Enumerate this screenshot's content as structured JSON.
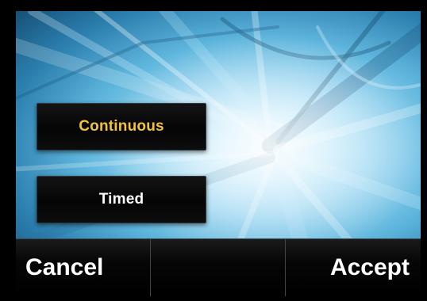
{
  "options": {
    "continuous_label": "Continuous",
    "timed_label": "Timed"
  },
  "softkeys": {
    "left_label": "Cancel",
    "middle_label": "",
    "right_label": "Accept"
  },
  "colors": {
    "selected_text": "#f3c43a",
    "unselected_text": "#ffffff",
    "softkey_bar": "#060606"
  }
}
